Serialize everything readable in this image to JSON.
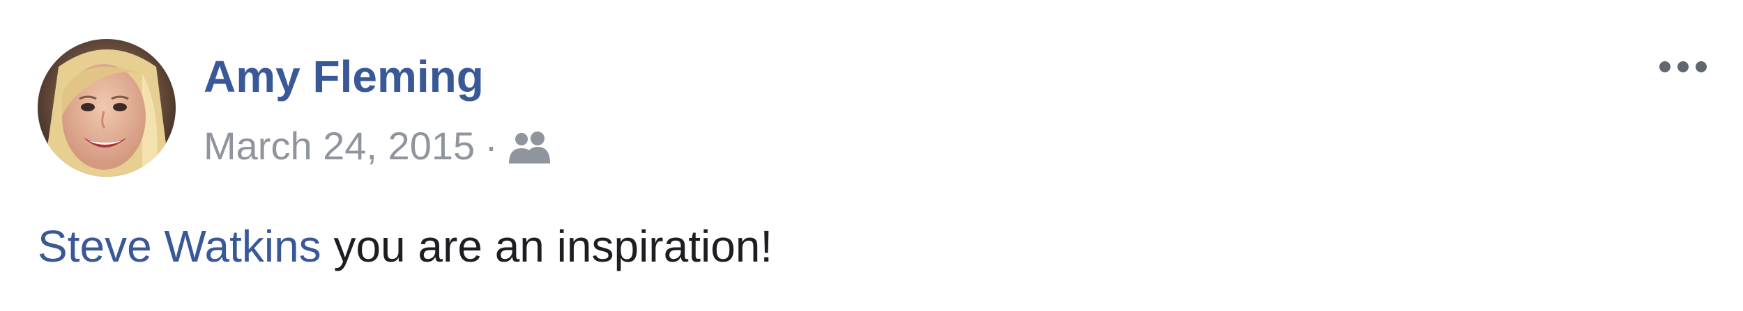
{
  "post": {
    "author": {
      "name": "Amy Fleming",
      "avatar_icon": "profile-photo"
    },
    "date": "March 24, 2015",
    "separator": "·",
    "audience_icon": "friends-icon",
    "more_icon": "more-options-icon",
    "body": {
      "mention": "Steve Watkins",
      "text": " you are an inspiration!"
    }
  },
  "colors": {
    "link": "#385898",
    "meta": "#90949c",
    "text": "#1c1e21",
    "icon": "#90949c",
    "background": "#ffffff"
  }
}
